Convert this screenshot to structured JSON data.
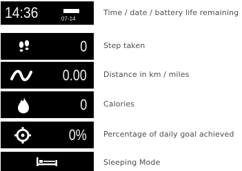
{
  "rows": [
    {
      "icon": "clock-time",
      "time": "14:36",
      "date": "07-14",
      "description": "Time / date / battery life remaining"
    },
    {
      "icon": "footprints-icon",
      "value": "0",
      "description": "Step taken"
    },
    {
      "icon": "distance-wave-icon",
      "value": "0.00",
      "description": "Distance in km / miles"
    },
    {
      "icon": "flame-drop-icon",
      "value": "0",
      "description": "Calories"
    },
    {
      "icon": "target-crosshair-icon",
      "value": "0%",
      "description": "Percentage of daily goal achieved"
    },
    {
      "icon": "bed-icon",
      "description": "Sleeping Mode"
    }
  ],
  "colors": {
    "panel_background": "#000000",
    "panel_text": "#ffffff",
    "description_text": "#4d4d4d"
  }
}
